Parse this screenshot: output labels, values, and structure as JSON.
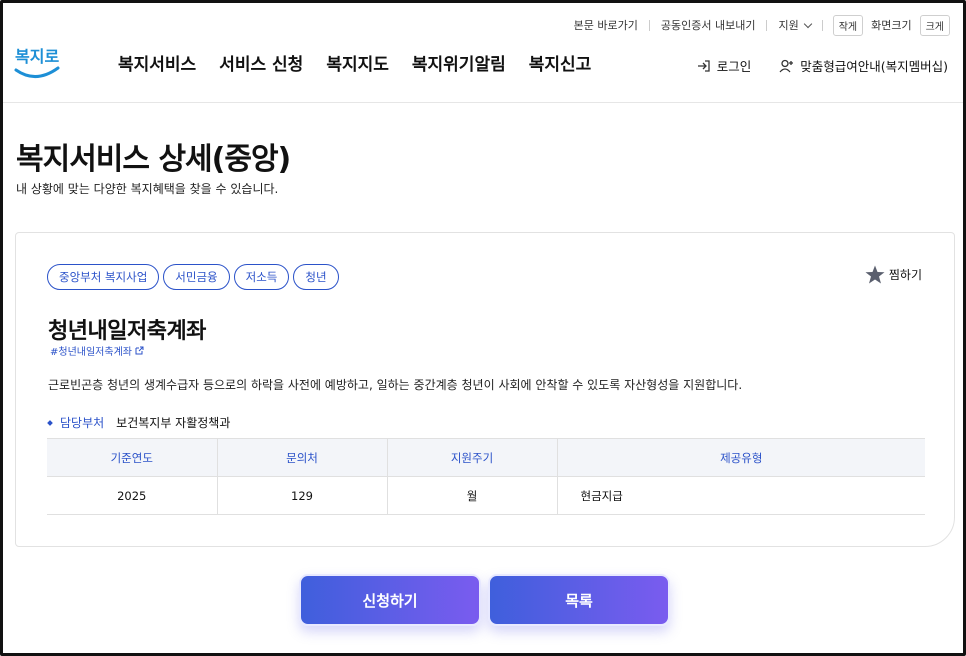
{
  "util": {
    "skip": "본문 바로가기",
    "cert": "공동인증서 내보내기",
    "region": "지원",
    "font_small": "작게",
    "font_label": "화면크기",
    "font_large": "크게"
  },
  "logo": {
    "text": "복지로"
  },
  "gnb": [
    "복지서비스",
    "서비스 신청",
    "복지지도",
    "복지위기알림",
    "복지신고"
  ],
  "header": {
    "login": "로그인",
    "guide": "맞춤형급여안내(복지멤버십)"
  },
  "page": {
    "title": "복지서비스 상세(중앙)",
    "desc": "내 상황에 맞는 다양한 복지혜택을 찾을 수 있습니다."
  },
  "service": {
    "tags": [
      "중앙부처 복지사업",
      "서민금융",
      "저소득",
      "청년"
    ],
    "favorite": "찜하기",
    "title": "청년내일저축계좌",
    "hashtag": "#청년내일저축계좌",
    "description": "근로빈곤층 청년의 생계수급자 등으로의 하락을 사전에 예방하고, 일하는 중간계층 청년이 사회에 안착할 수 있도록 자산형성을 지원합니다.",
    "dept_label": "담당부처",
    "dept_value": "보건복지부 자활정책과",
    "table": {
      "headers": [
        "기준연도",
        "문의처",
        "지원주기",
        "제공유형"
      ],
      "row": [
        "2025",
        "129",
        "월",
        "현금지급"
      ]
    }
  },
  "buttons": {
    "apply": "신청하기",
    "list": "목록"
  },
  "colors": {
    "accent": "#2b52c9",
    "logo": "#1d8fd6",
    "button_start": "#3f5fdc",
    "button_end": "#7a5cef"
  }
}
